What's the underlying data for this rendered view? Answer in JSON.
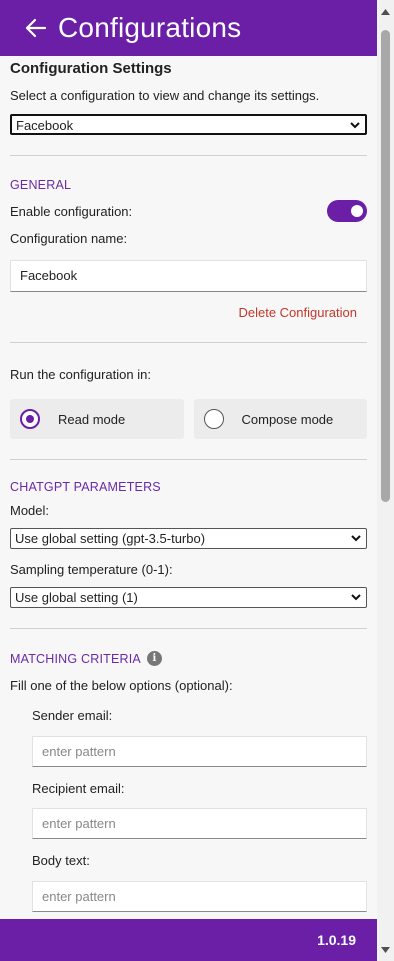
{
  "header": {
    "title": "Configurations",
    "back_icon": "arrow-left-icon"
  },
  "config_settings": {
    "title": "Configuration Settings",
    "description": "Select a configuration to view and change its settings.",
    "selected": "Facebook"
  },
  "general": {
    "label": "GENERAL",
    "enable_label": "Enable configuration:",
    "enabled": true,
    "name_label": "Configuration name:",
    "name_value": "Facebook",
    "delete_label": "Delete Configuration"
  },
  "run_mode": {
    "label": "Run the configuration in:",
    "options": [
      {
        "label": "Read mode",
        "checked": true
      },
      {
        "label": "Compose mode",
        "checked": false
      }
    ]
  },
  "chatgpt": {
    "label": "CHATGPT PARAMETERS",
    "model_label": "Model:",
    "model_value": "Use global setting (gpt-3.5-turbo)",
    "temp_label": "Sampling temperature (0-1):",
    "temp_value": "Use global setting (1)"
  },
  "matching": {
    "label": "MATCHING CRITERIA",
    "description": "Fill one of the below options (optional):",
    "fields": [
      {
        "label": "Sender email:",
        "placeholder": "enter pattern"
      },
      {
        "label": "Recipient email:",
        "placeholder": "enter pattern"
      },
      {
        "label": "Body text:",
        "placeholder": "enter pattern"
      }
    ]
  },
  "footer": {
    "version": "1.0.19"
  },
  "colors": {
    "brand": "#6a1fa6",
    "delete": "#c0392b"
  }
}
